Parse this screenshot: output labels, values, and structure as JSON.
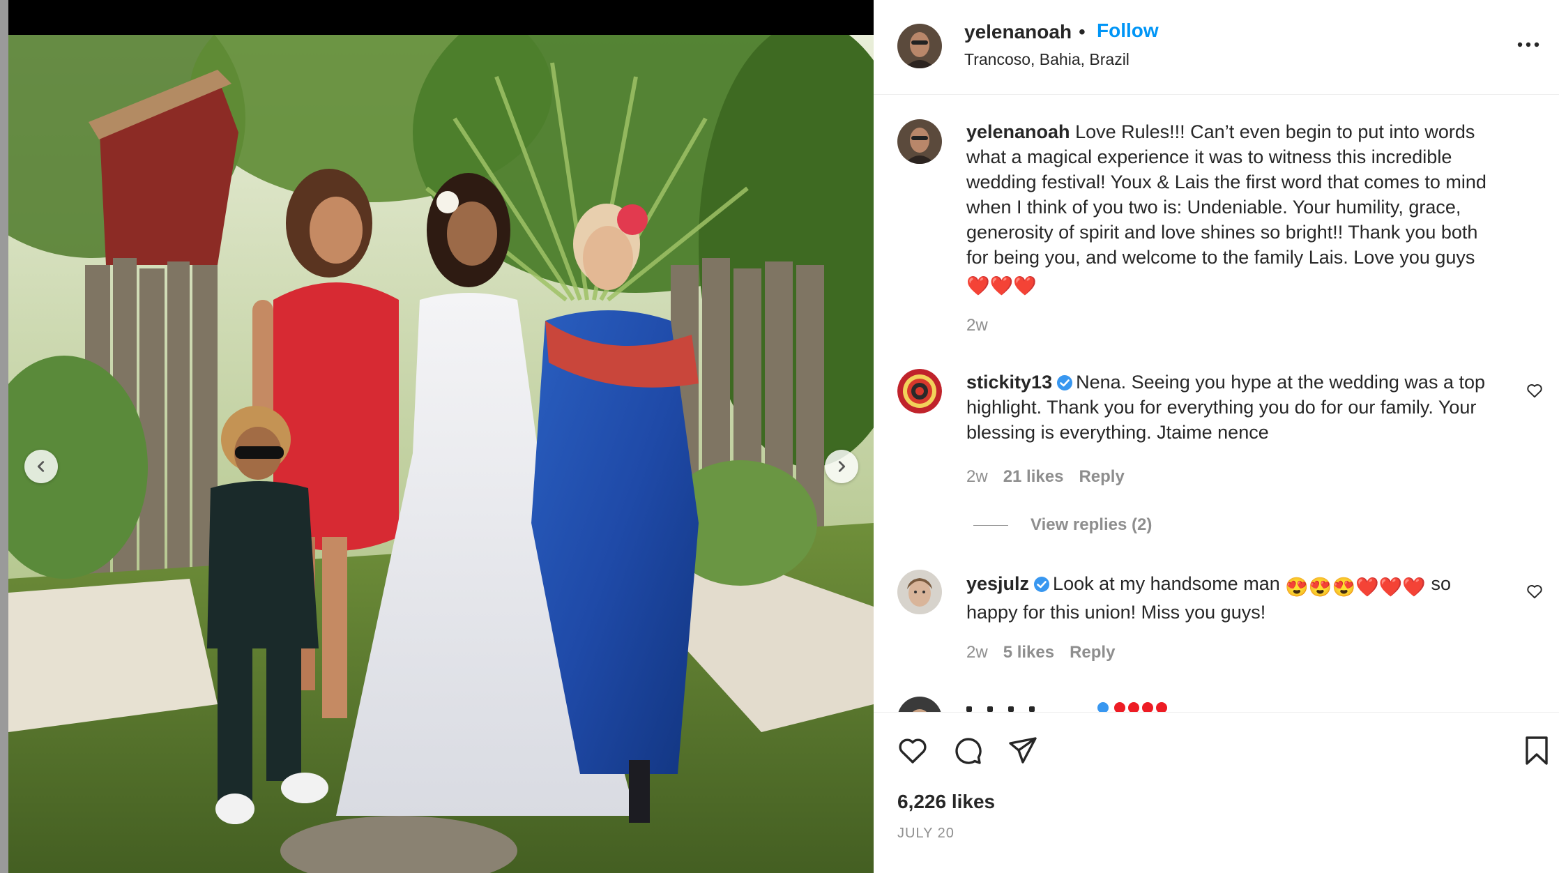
{
  "post": {
    "username": "yelenanoah",
    "dot": "•",
    "follow_label": "Follow",
    "location": "Trancoso, Bahia, Brazil",
    "more_icon": "more-horizontal-icon"
  },
  "caption": {
    "username": "yelenanoah",
    "text": "Love Rules!!! Can’t even begin to put into words what a magical experience it was to witness this incredible wedding festival! Youx & Lais the first word that comes to mind when I think of you two is: Undeniable. Your humility, grace, generosity of spirit and love shines so bright!! Thank you both for being you, and welcome to the family Lais. Love you guys",
    "emoji": "❤️❤️❤️",
    "time": "2w"
  },
  "comments": [
    {
      "username": "stickity13",
      "verified": true,
      "text": "Nena. Seeing you hype at the wedding was a top highlight. Thank you for everything you do for our family. Your blessing is everything. Jtaime nence",
      "time": "2w",
      "likes": "21 likes",
      "reply_label": "Reply",
      "view_replies": "View replies (2)"
    },
    {
      "username": "yesjulz",
      "verified": true,
      "text_before": "Look at my handsome man",
      "emoji": "😍😍😍❤️❤️❤️",
      "text_after": "so happy for this union! Miss you guys!",
      "time": "2w",
      "likes": "5 likes",
      "reply_label": "Reply"
    }
  ],
  "footer": {
    "likes": "6,226 likes",
    "date": "JULY 20"
  },
  "colors": {
    "accent": "#0095f6",
    "muted": "#8e8e8e",
    "text": "#262626",
    "heart_red": "#ed1c24"
  }
}
